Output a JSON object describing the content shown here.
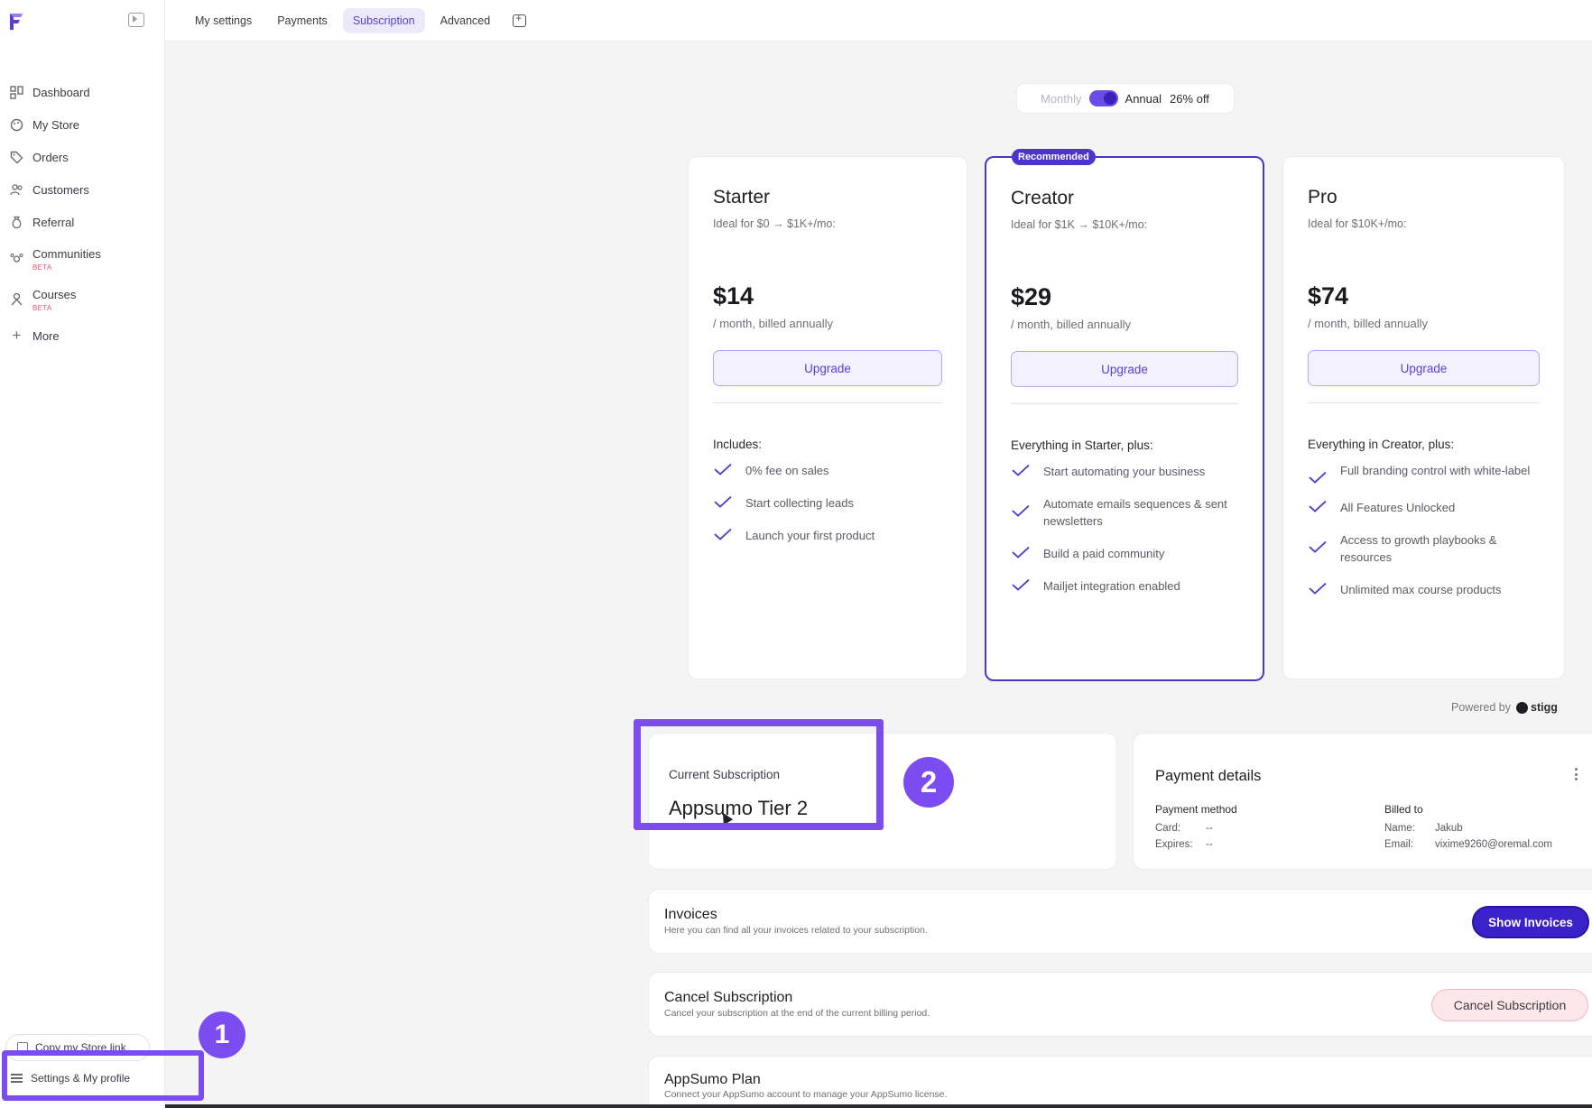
{
  "tabs": [
    "My settings",
    "Payments",
    "Subscription",
    "Advanced"
  ],
  "active_tab": "Subscription",
  "sidebar": {
    "items": [
      {
        "label": "Dashboard",
        "icon": "dashboard-icon"
      },
      {
        "label": "My Store",
        "icon": "store-icon"
      },
      {
        "label": "Orders",
        "icon": "tag-icon"
      },
      {
        "label": "Customers",
        "icon": "users-icon"
      },
      {
        "label": "Referral",
        "icon": "money-bag-icon"
      },
      {
        "label": "Communities",
        "beta": "BETA",
        "icon": "community-icon"
      },
      {
        "label": "Courses",
        "beta": "BETA",
        "icon": "courses-icon"
      },
      {
        "label": "More",
        "icon": "plus-icon"
      }
    ],
    "copy_link": "Copy my Store link",
    "settings": "Settings & My profile"
  },
  "billing_toggle": {
    "monthly": "Monthly",
    "annual": "Annual",
    "discount": "26% off",
    "annual_selected": true
  },
  "plans": [
    {
      "name": "Starter",
      "ideal": "Ideal for $0 → $1K+/mo:",
      "price": "$14",
      "billed": "/ month, billed annually",
      "button": "Upgrade",
      "includes_title": "Includes:",
      "features": [
        "0% fee on sales",
        "Start collecting leads",
        "Launch your first product"
      ]
    },
    {
      "name": "Creator",
      "badge": "Recommended",
      "ideal": "Ideal for $1K → $10K+/mo:",
      "price": "$29",
      "billed": "/ month, billed annually",
      "button": "Upgrade",
      "includes_title": "Everything in Starter, plus:",
      "features": [
        "Start automating your business",
        "Automate emails sequences & sent newsletters",
        "Build a paid community",
        "Mailjet integration enabled"
      ]
    },
    {
      "name": "Pro",
      "ideal": "Ideal for $10K+/mo:",
      "price": "$74",
      "billed": "/ month, billed annually",
      "button": "Upgrade",
      "includes_title": "Everything in Creator, plus:",
      "features": [
        "Full branding control with white-label",
        "All Features Unlocked",
        "Access to growth playbooks & resources",
        "Unlimited max course products"
      ]
    }
  ],
  "powered_by": {
    "label": "Powered by",
    "brand": "stigg"
  },
  "current_subscription": {
    "label": "Current Subscription",
    "value": "Appsumo Tier 2"
  },
  "payment_details": {
    "title": "Payment details",
    "method_title": "Payment method",
    "card_label": "Card:",
    "card_value": "--",
    "expires_label": "Expires:",
    "expires_value": "--",
    "billed_title": "Billed to",
    "name_label": "Name:",
    "name_value": "Jakub",
    "email_label": "Email:",
    "email_value": "vixime9260@oremal.com"
  },
  "invoices": {
    "title": "Invoices",
    "desc": "Here you can find all your invoices related to your subscription.",
    "button": "Show Invoices"
  },
  "cancel": {
    "title": "Cancel Subscription",
    "desc": "Cancel your subscription at the end of the current billing period.",
    "button": "Cancel Subscription"
  },
  "appsumo": {
    "title": "AppSumo Plan",
    "desc": "Connect your AppSumo account to manage your AppSumo license."
  },
  "annotations": {
    "step1": "1",
    "step2": "2",
    "color": "#7b4cf0"
  },
  "colors": {
    "accent": "#4e35c9",
    "brand_purple": "#7b4cf0",
    "cancel_bg": "#fde7ea"
  }
}
